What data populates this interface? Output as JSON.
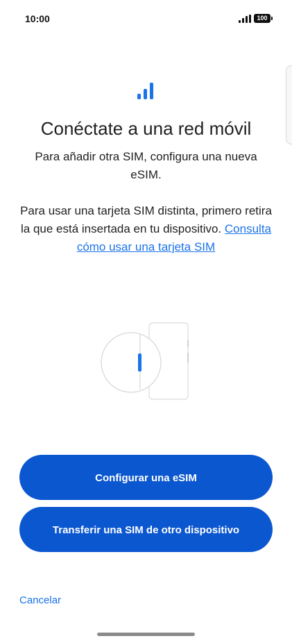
{
  "status_bar": {
    "time": "10:00",
    "battery": "100",
    "icons": [
      "signal-icon",
      "battery-icon"
    ]
  },
  "header": {
    "icon": "signal-icon",
    "title": "Conéctate a una red móvil",
    "subtitle": "Para añadir otra SIM, configura una nueva eSIM."
  },
  "body": {
    "text": "Para usar una tarjeta SIM distinta, primero retira la que está insertada en tu dispositivo.",
    "link": "Consulta cómo usar una tarjeta SIM"
  },
  "illustration": {
    "icon": "sim-tray-illustration-icon"
  },
  "actions": {
    "configure_esim": "Configurar una eSIM",
    "transfer_sim": "Transferir una SIM de otro dispositivo",
    "cancel": "Cancelar"
  },
  "colors": {
    "accent": "#1a73e8",
    "button": "#0b57d0"
  }
}
